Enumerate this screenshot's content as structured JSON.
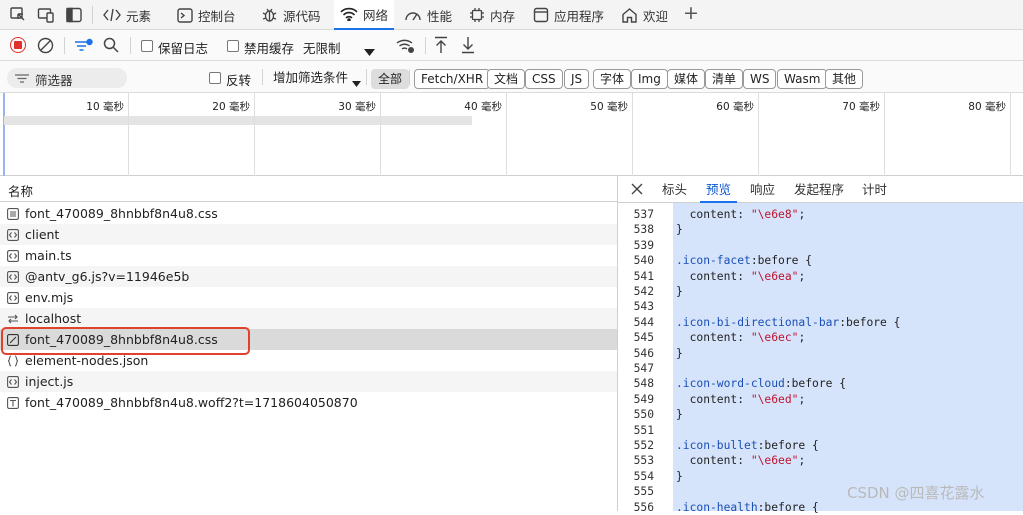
{
  "devtools_tabs": [
    {
      "label": "元素",
      "icon": "code-brackets-icon"
    },
    {
      "label": "控制台",
      "icon": "console-icon"
    },
    {
      "label": "源代码",
      "icon": "bug-icon"
    },
    {
      "label": "网络",
      "icon": "wifi-icon",
      "active": true
    },
    {
      "label": "性能",
      "icon": "gauge-icon"
    },
    {
      "label": "内存",
      "icon": "chip-icon"
    },
    {
      "label": "应用程序",
      "icon": "app-storage-icon"
    },
    {
      "label": "欢迎",
      "icon": "house-icon"
    }
  ],
  "toolbar": {
    "preserve_log": "保留日志",
    "disable_cache": "禁用缓存",
    "throttling": "无限制"
  },
  "filterbar": {
    "filter_placeholder": "筛选器",
    "invert": "反转",
    "more_filters": "增加筛选条件",
    "chips": [
      "全部",
      "Fetch/XHR",
      "文档",
      "CSS",
      "JS",
      "字体",
      "Img",
      "媒体",
      "清单",
      "WS",
      "Wasm",
      "其他"
    ],
    "selected_chip": "全部"
  },
  "timeline": {
    "ticks": [
      "10 毫秒",
      "20 毫秒",
      "30 毫秒",
      "40 毫秒",
      "50 毫秒",
      "60 毫秒",
      "70 毫秒",
      "80 毫秒"
    ]
  },
  "request_list": {
    "column_name": "名称",
    "rows": [
      {
        "name": "font_470089_8hnbbf8n4u8.css",
        "type": "doc"
      },
      {
        "name": "client",
        "type": "script"
      },
      {
        "name": "main.ts",
        "type": "script"
      },
      {
        "name": "@antv_g6.js?v=11946e5b",
        "type": "script"
      },
      {
        "name": "env.mjs",
        "type": "script"
      },
      {
        "name": "localhost",
        "type": "ws"
      },
      {
        "name": "font_470089_8hnbbf8n4u8.css",
        "type": "css",
        "selected": true
      },
      {
        "name": "element-nodes.json",
        "type": "json"
      },
      {
        "name": "inject.js",
        "type": "script"
      },
      {
        "name": "font_470089_8hnbbf8n4u8.woff2?t=1718604050870",
        "type": "font"
      }
    ]
  },
  "detail_tabs": [
    "标头",
    "预览",
    "响应",
    "发起程序",
    "计时"
  ],
  "detail_active_tab": "预览",
  "code_lines": [
    {
      "n": "537",
      "sel": "",
      "rest": "  content: ",
      "str": "\"\\e6e8\"",
      "end": ";"
    },
    {
      "n": "538",
      "sel": "",
      "rest": "}",
      "str": "",
      "end": ""
    },
    {
      "n": "539",
      "sel": "",
      "rest": "",
      "str": "",
      "end": ""
    },
    {
      "n": "540",
      "sel": ".icon-facet",
      "rest": ":before {",
      "str": "",
      "end": ""
    },
    {
      "n": "541",
      "sel": "",
      "rest": "  content: ",
      "str": "\"\\e6ea\"",
      "end": ";"
    },
    {
      "n": "542",
      "sel": "",
      "rest": "}",
      "str": "",
      "end": ""
    },
    {
      "n": "543",
      "sel": "",
      "rest": "",
      "str": "",
      "end": ""
    },
    {
      "n": "544",
      "sel": ".icon-bi-directional-bar",
      "rest": ":before {",
      "str": "",
      "end": ""
    },
    {
      "n": "545",
      "sel": "",
      "rest": "  content: ",
      "str": "\"\\e6ec\"",
      "end": ";"
    },
    {
      "n": "546",
      "sel": "",
      "rest": "}",
      "str": "",
      "end": ""
    },
    {
      "n": "547",
      "sel": "",
      "rest": "",
      "str": "",
      "end": ""
    },
    {
      "n": "548",
      "sel": ".icon-word-cloud",
      "rest": ":before {",
      "str": "",
      "end": ""
    },
    {
      "n": "549",
      "sel": "",
      "rest": "  content: ",
      "str": "\"\\e6ed\"",
      "end": ";"
    },
    {
      "n": "550",
      "sel": "",
      "rest": "}",
      "str": "",
      "end": ""
    },
    {
      "n": "551",
      "sel": "",
      "rest": "",
      "str": "",
      "end": ""
    },
    {
      "n": "552",
      "sel": ".icon-bullet",
      "rest": ":before {",
      "str": "",
      "end": ""
    },
    {
      "n": "553",
      "sel": "",
      "rest": "  content: ",
      "str": "\"\\e6ee\"",
      "end": ";"
    },
    {
      "n": "554",
      "sel": "",
      "rest": "}",
      "str": "",
      "end": ""
    },
    {
      "n": "555",
      "sel": "",
      "rest": "",
      "str": "",
      "end": ""
    },
    {
      "n": "556",
      "sel": ".icon-health",
      "rest": ":before {",
      "str": "",
      "end": ""
    }
  ],
  "watermark": "CSDN @四喜花露水",
  "colors": {
    "accent": "#1a73e8",
    "highlight_box": "#e0422f",
    "code_selection": "#d6e4fb",
    "record_red": "#e0312b"
  }
}
